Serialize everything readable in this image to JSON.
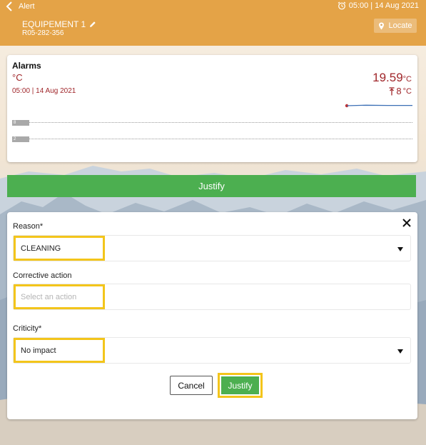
{
  "header": {
    "back_label": "Alert",
    "datetime": "05:00 | 14 Aug 2021",
    "equipment_name": "EQUIPEMENT 1",
    "serial": "R05-282-356",
    "locate_label": "Locate",
    "bar_color": "#e4a347"
  },
  "alarm_card": {
    "title": "Alarms",
    "unit": "°C",
    "date": "05:00 | 14 Aug 2021",
    "temperature": "19.59",
    "temperature_unit": "°C",
    "threshold": "8",
    "threshold_unit": "°C",
    "threshold_rows": [
      {
        "label": "8"
      },
      {
        "label": "2"
      }
    ],
    "alarm_color": "#a0262a",
    "line_color": "#3b6fb5"
  },
  "justify_bar": {
    "label": "Justify",
    "color": "#4caf50"
  },
  "form": {
    "reason": {
      "label": "Reason*",
      "value": "CLEANING"
    },
    "corrective_action": {
      "label": "Corrective action",
      "placeholder": "Select an action"
    },
    "criticity": {
      "label": "Criticity*",
      "value": "No impact"
    },
    "cancel_label": "Cancel",
    "justify_label": "Justify",
    "highlight_color": "#f3c51b"
  }
}
